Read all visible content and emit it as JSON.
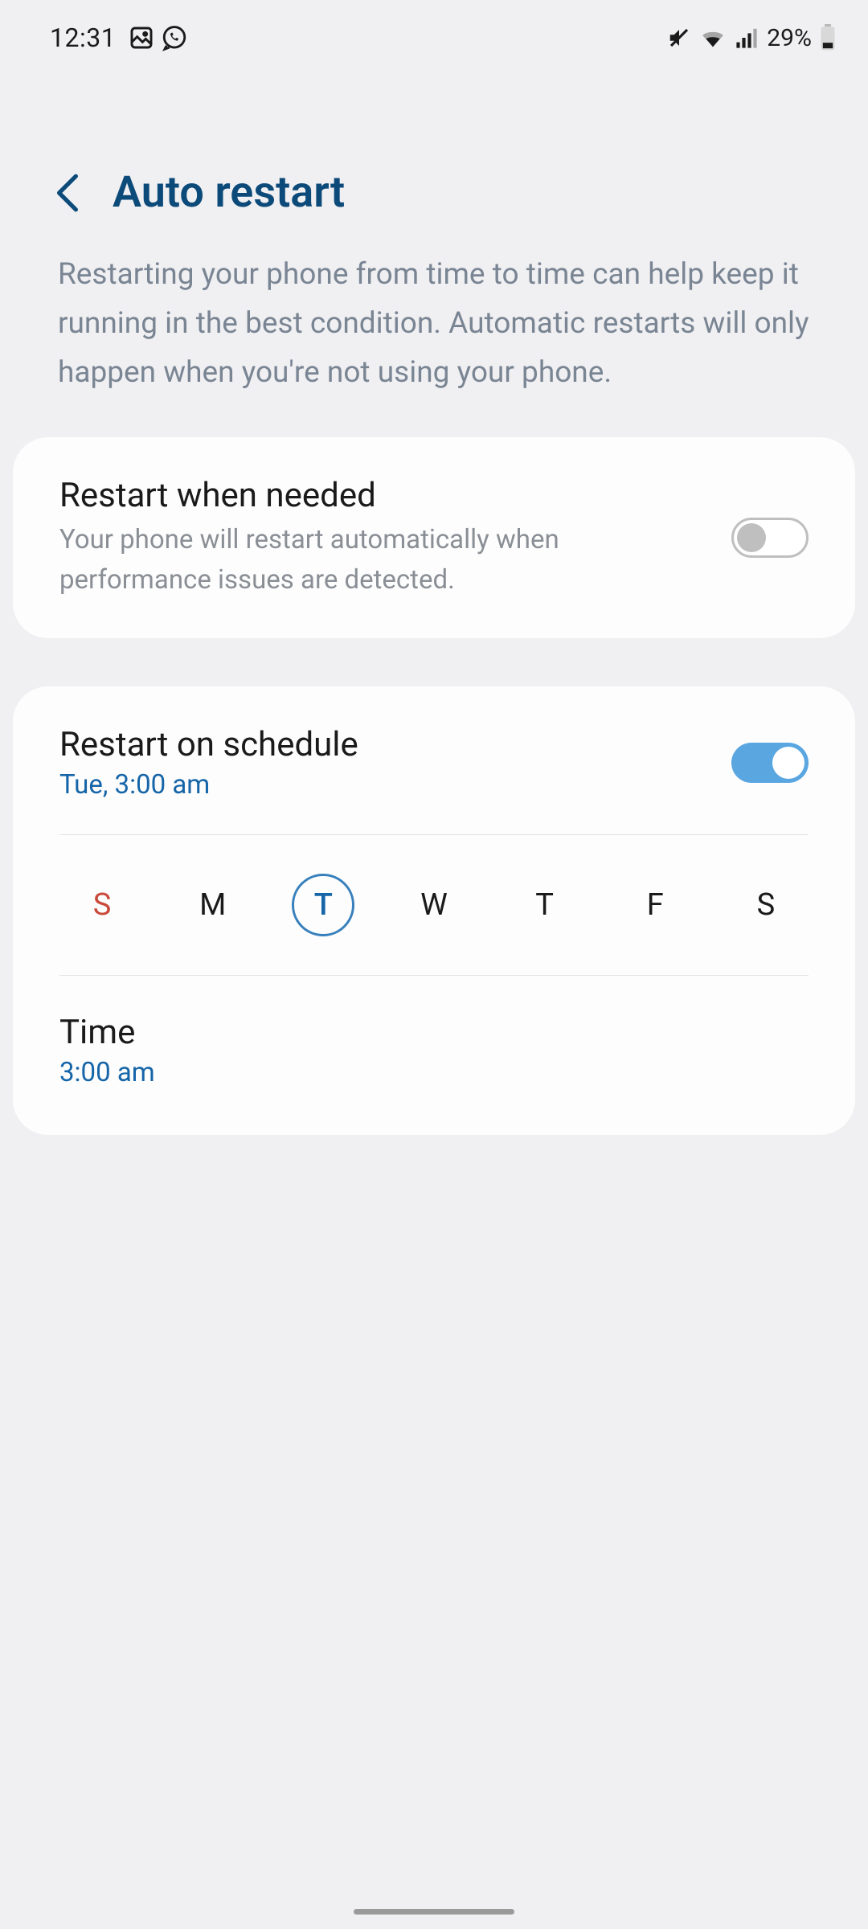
{
  "statusBar": {
    "time": "12:31",
    "battery": "29%"
  },
  "header": {
    "title": "Auto restart"
  },
  "description": "Restarting your phone from time to time can help keep it running in the best condition. Automatic restarts will only happen when you're not using your phone.",
  "card1": {
    "title": "Restart when needed",
    "desc": "Your phone will restart automatically when performance issues are detected.",
    "toggle": false
  },
  "card2": {
    "title": "Restart on schedule",
    "sub": "Tue, 3:00 am",
    "toggle": true,
    "days": [
      {
        "label": "S",
        "sunday": true,
        "selected": false
      },
      {
        "label": "M",
        "sunday": false,
        "selected": false
      },
      {
        "label": "T",
        "sunday": false,
        "selected": true
      },
      {
        "label": "W",
        "sunday": false,
        "selected": false
      },
      {
        "label": "T",
        "sunday": false,
        "selected": false
      },
      {
        "label": "F",
        "sunday": false,
        "selected": false
      },
      {
        "label": "S",
        "sunday": false,
        "selected": false
      }
    ],
    "timeLabel": "Time",
    "timeValue": "3:00 am"
  }
}
